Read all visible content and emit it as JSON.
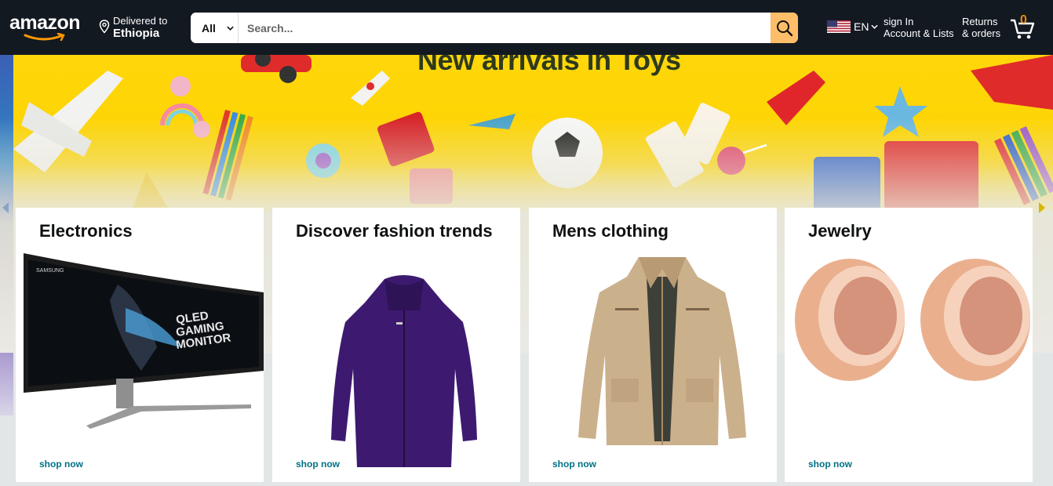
{
  "header": {
    "logo_text": "amazon",
    "deliver_line1": "Delivered to",
    "deliver_line2": "Ethiopia",
    "search_category": "All",
    "search_placeholder": "Search...",
    "language": "EN",
    "account_line1": "sign In",
    "account_line2": "Account & Lists",
    "returns_line1": "Returns",
    "returns_line2": "& orders",
    "cart_count": "0"
  },
  "hero": {
    "title": "New arrivals in Toys"
  },
  "cards": [
    {
      "title": "Electronics",
      "link": "shop now",
      "image": "qled-gaming-monitor"
    },
    {
      "title": "Discover fashion trends",
      "link": "shop now",
      "image": "purple-jacket"
    },
    {
      "title": "Mens clothing",
      "link": "shop now",
      "image": "khaki-jacket"
    },
    {
      "title": "Jewelry",
      "link": "shop now",
      "image": "rose-gold-rings"
    }
  ],
  "monitor_brand": "SAMSUNG",
  "monitor_text": "QLED GAMING MONITOR",
  "colors": {
    "header_bg": "#131921",
    "search_button": "#febd69",
    "link": "#007185",
    "cart_count": "#f08804",
    "hero_bg": "#fdd400"
  },
  "icons": {
    "location": "location-pin-icon",
    "search": "search-icon",
    "cart": "cart-icon",
    "flag": "us-flag-icon"
  }
}
